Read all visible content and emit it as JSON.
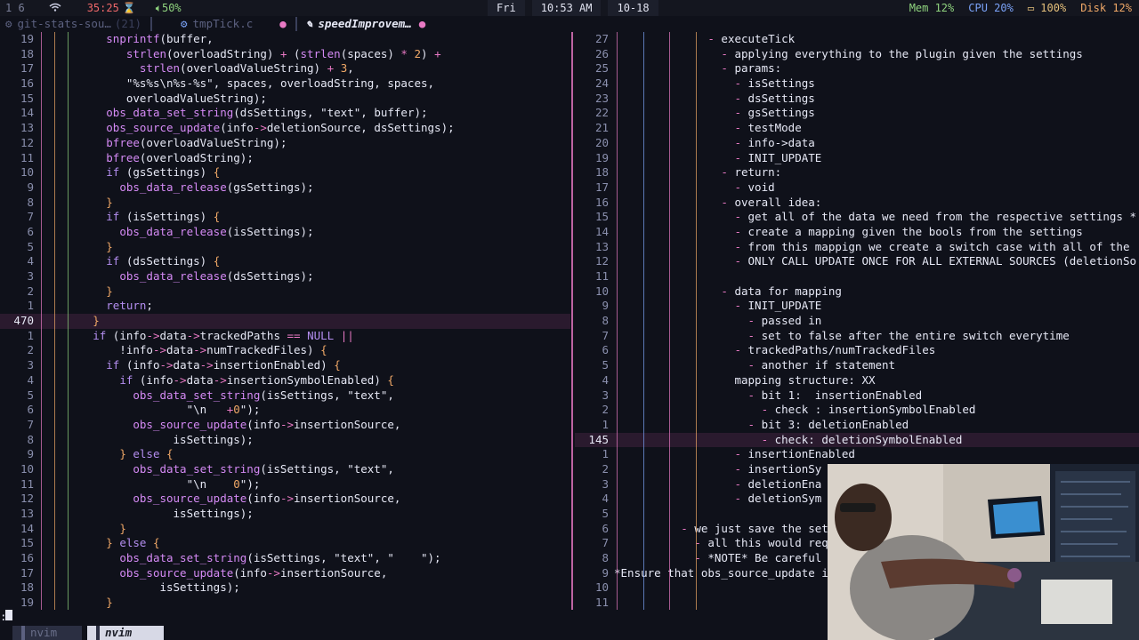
{
  "topbar": {
    "workspaces": "1  6",
    "timer": "35:25",
    "volume": "50%",
    "day": "Fri",
    "time": "10:53 AM",
    "date": "10-18",
    "mem": "Mem 12%",
    "cpu": "CPU 20%",
    "battery": "100%",
    "disk": "Disk 12%"
  },
  "tabline": {
    "tabs": [
      {
        "label": "git-stats-sou…",
        "badge": "(21)"
      },
      {
        "label": "tmpTick.c"
      },
      {
        "label": "speedImprovem…"
      }
    ]
  },
  "left_code": {
    "lines": [
      {
        "n": "19",
        "t": "          snprintf(buffer,"
      },
      {
        "n": "18",
        "t": "             strlen(overloadString) + (strlen(spaces) * 2) +"
      },
      {
        "n": "17",
        "t": "               strlen(overloadValueString) + 3,"
      },
      {
        "n": "16",
        "t": "             \"%s%s\\n%s-%s\", spaces, overloadString, spaces,"
      },
      {
        "n": "15",
        "t": "             overloadValueString);"
      },
      {
        "n": "14",
        "t": "          obs_data_set_string(dsSettings, \"text\", buffer);"
      },
      {
        "n": "13",
        "t": "          obs_source_update(info->deletionSource, dsSettings);"
      },
      {
        "n": "12",
        "t": "          bfree(overloadValueString);"
      },
      {
        "n": "11",
        "t": "          bfree(overloadString);"
      },
      {
        "n": "10",
        "t": "          if (gsSettings) {"
      },
      {
        "n": "9",
        "t": "            obs_data_release(gsSettings);"
      },
      {
        "n": "8",
        "t": "          }"
      },
      {
        "n": "7",
        "t": "          if (isSettings) {"
      },
      {
        "n": "6",
        "t": "            obs_data_release(isSettings);"
      },
      {
        "n": "5",
        "t": "          }"
      },
      {
        "n": "4",
        "t": "          if (dsSettings) {"
      },
      {
        "n": "3",
        "t": "            obs_data_release(dsSettings);"
      },
      {
        "n": "2",
        "t": "          }"
      },
      {
        "n": "1",
        "t": "          return;"
      },
      {
        "n": "470",
        "t": "        }"
      },
      {
        "n": "1",
        "t": "        if (info->data->trackedPaths == NULL ||"
      },
      {
        "n": "2",
        "t": "            !info->data->numTrackedFiles) {"
      },
      {
        "n": "3",
        "t": "          if (info->data->insertionEnabled) {"
      },
      {
        "n": "4",
        "t": "            if (info->data->insertionSymbolEnabled) {"
      },
      {
        "n": "5",
        "t": "              obs_data_set_string(isSettings, \"text\","
      },
      {
        "n": "6",
        "t": "                      \"\\n   +0\");"
      },
      {
        "n": "7",
        "t": "              obs_source_update(info->insertionSource,"
      },
      {
        "n": "8",
        "t": "                    isSettings);"
      },
      {
        "n": "9",
        "t": "            } else {"
      },
      {
        "n": "10",
        "t": "              obs_data_set_string(isSettings, \"text\","
      },
      {
        "n": "11",
        "t": "                      \"\\n    0\");"
      },
      {
        "n": "12",
        "t": "              obs_source_update(info->insertionSource,"
      },
      {
        "n": "13",
        "t": "                    isSettings);"
      },
      {
        "n": "14",
        "t": "            }"
      },
      {
        "n": "15",
        "t": "          } else {"
      },
      {
        "n": "16",
        "t": "            obs_data_set_string(isSettings, \"text\", \"    \");"
      },
      {
        "n": "17",
        "t": "            obs_source_update(info->insertionSource,"
      },
      {
        "n": "18",
        "t": "                  isSettings);"
      },
      {
        "n": "19",
        "t": "          }"
      }
    ]
  },
  "right_notes": {
    "lines": [
      {
        "n": "27",
        "t": "              - executeTick"
      },
      {
        "n": "26",
        "t": "                - applying everything to the plugin given the settings"
      },
      {
        "n": "25",
        "t": "                - params:"
      },
      {
        "n": "24",
        "t": "                  - isSettings"
      },
      {
        "n": "23",
        "t": "                  - dsSettings"
      },
      {
        "n": "22",
        "t": "                  - gsSettings"
      },
      {
        "n": "21",
        "t": "                  - testMode"
      },
      {
        "n": "20",
        "t": "                  - info->data"
      },
      {
        "n": "19",
        "t": "                  - INIT_UPDATE"
      },
      {
        "n": "18",
        "t": "                - return:"
      },
      {
        "n": "17",
        "t": "                  - void"
      },
      {
        "n": "16",
        "t": "                - overall idea:"
      },
      {
        "n": "15",
        "t": "                  - get all of the data we need from the respective settings *"
      },
      {
        "n": "14",
        "t": "                  - create a mapping given the bools from the settings"
      },
      {
        "n": "13",
        "t": "                  - from this mappign we create a switch case with all of the"
      },
      {
        "n": "12",
        "t": "                  - ONLY CALL UPDATE ONCE FOR ALL EXTERNAL SOURCES (deletionSo"
      },
      {
        "n": "11",
        "t": ""
      },
      {
        "n": "10",
        "t": "                - data for mapping"
      },
      {
        "n": "9",
        "t": "                  - INIT_UPDATE"
      },
      {
        "n": "8",
        "t": "                    - passed in"
      },
      {
        "n": "7",
        "t": "                    - set to false after the entire switch everytime"
      },
      {
        "n": "6",
        "t": "                  - trackedPaths/numTrackedFiles"
      },
      {
        "n": "5",
        "t": "                    - another if statement"
      },
      {
        "n": "4",
        "t": "                  mapping structure: XX"
      },
      {
        "n": "3",
        "t": "                    - bit 1:  insertionEnabled"
      },
      {
        "n": "2",
        "t": "                      - check : insertionSymbolEnabled"
      },
      {
        "n": "1",
        "t": "                    - bit 3: deletionEnabled"
      },
      {
        "n": "145",
        "t": "                      - check: deletionSymbolEnabled"
      },
      {
        "n": "1",
        "t": "                  - insertionEnabled"
      },
      {
        "n": "2",
        "t": "                  - insertionSy"
      },
      {
        "n": "3",
        "t": "                  - deletionEna"
      },
      {
        "n": "4",
        "t": "                  - deletionSym"
      },
      {
        "n": "5",
        "t": ""
      },
      {
        "n": "6",
        "t": "          - we just save the settings c"
      },
      {
        "n": "7",
        "t": "            - all this would require"
      },
      {
        "n": "8",
        "t": "            - *NOTE* Be careful as bo"
      },
      {
        "n": "9",
        "t": "*Ensure that obs_source_update is"
      },
      {
        "n": "10",
        "t": ""
      },
      {
        "n": "11",
        "t": ""
      }
    ]
  },
  "statusline": {
    "cmd": ":",
    "tab1": "nvim",
    "tab2": "nvim"
  },
  "colors": {
    "accent": "#e879c4",
    "background": "#0f111a",
    "cursorline": "#2a1a2e"
  }
}
